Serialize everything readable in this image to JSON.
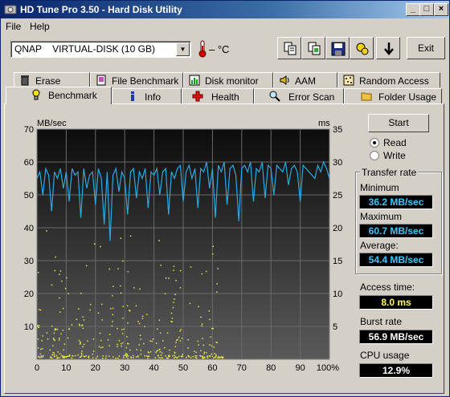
{
  "window": {
    "title": "HD Tune Pro 3.50 - Hard Disk Utility"
  },
  "menu": {
    "file": "File",
    "help": "Help"
  },
  "toolbar": {
    "drive": "QNAP    VIRTUAL-DISK (10 GB)",
    "temperature": "– °C",
    "exit_label": "Exit"
  },
  "tabs_top": [
    "Erase",
    "File Benchmark",
    "Disk monitor",
    "AAM",
    "Random Access"
  ],
  "tabs_bottom": [
    "Benchmark",
    "Info",
    "Health",
    "Error Scan",
    "Folder Usage"
  ],
  "controls": {
    "start_label": "Start",
    "read_label": "Read",
    "write_label": "Write",
    "read_selected": true
  },
  "stats": {
    "transfer_rate_title": "Transfer rate",
    "minimum_label": "Minimum",
    "minimum_value": "36.2 MB/sec",
    "maximum_label": "Maximum",
    "maximum_value": "60.7 MB/sec",
    "average_label": "Average:",
    "average_value": "54.4 MB/sec",
    "access_time_label": "Access time:",
    "access_time_value": "8.0 ms",
    "burst_rate_label": "Burst rate",
    "burst_rate_value": "56.9 MB/sec",
    "cpu_usage_label": "CPU usage",
    "cpu_usage_value": "12.9%"
  },
  "colors": {
    "transfer_line": "#2aa8e0",
    "access_dots": "#e8e84a",
    "value_blue": "#37c8ff",
    "value_yellow": "#ffff40",
    "value_white": "#ffffff",
    "chart_bg_top": "#0c0c0c",
    "chart_bg_bottom": "#5a5a5a"
  },
  "chart_data": {
    "type": "line",
    "left_unit": "MB/sec",
    "right_unit": "ms",
    "y_left_ticks": [
      "70",
      "60",
      "50",
      "40",
      "30",
      "20",
      "10"
    ],
    "y_right_ticks": [
      "35",
      "30",
      "25",
      "20",
      "15",
      "10",
      "5"
    ],
    "x_ticks": [
      "0",
      "10",
      "20",
      "30",
      "40",
      "50",
      "60",
      "70",
      "80",
      "90",
      "100%"
    ],
    "ylim_left": [
      0,
      70
    ],
    "ylim_right": [
      0,
      35
    ],
    "xlim": [
      0,
      100
    ],
    "grid": true,
    "series": [
      {
        "name": "transfer rate",
        "x": [
          0,
          1,
          2,
          3,
          4,
          5,
          6,
          7,
          8,
          9,
          10,
          11,
          12,
          13,
          14,
          15,
          16,
          17,
          18,
          19,
          20,
          21,
          22,
          23,
          24,
          25,
          26,
          27,
          28,
          29,
          30,
          31,
          32,
          33,
          34,
          35,
          36,
          37,
          38,
          39,
          40,
          41,
          42,
          43,
          44,
          45,
          46,
          47,
          48,
          49,
          50,
          51,
          52,
          53,
          54,
          55,
          56,
          57,
          58,
          59,
          60,
          61,
          62,
          63,
          64,
          65,
          66,
          67,
          68,
          69,
          70,
          71,
          72,
          73,
          74,
          75,
          76,
          77,
          78,
          79,
          80,
          81,
          82,
          83,
          84,
          85,
          86,
          87,
          88,
          89,
          90,
          91,
          92,
          93,
          94,
          95,
          96,
          97,
          98,
          99,
          100
        ],
        "y": [
          55,
          57,
          50,
          58,
          56,
          45,
          57,
          55,
          58,
          52,
          57,
          48,
          58,
          56,
          57,
          43,
          58,
          52,
          56,
          57,
          47,
          58,
          55,
          41,
          57,
          36,
          56,
          58,
          51,
          57,
          55,
          44,
          57,
          58,
          49,
          57,
          55,
          58,
          46,
          57,
          56,
          58,
          50,
          57,
          58,
          44,
          57,
          55,
          58,
          59,
          48,
          57,
          59,
          55,
          58,
          46,
          58,
          57,
          60,
          52,
          58,
          43,
          59,
          57,
          60,
          47,
          58,
          59,
          56,
          42,
          58,
          59,
          57,
          60,
          48,
          58,
          57,
          60,
          49,
          59,
          58,
          50,
          59,
          58,
          57,
          60,
          53,
          58,
          59,
          57,
          48,
          59,
          58,
          57,
          56,
          55,
          59,
          57,
          60,
          58,
          55
        ]
      }
    ],
    "access_points_note_free": true
  }
}
